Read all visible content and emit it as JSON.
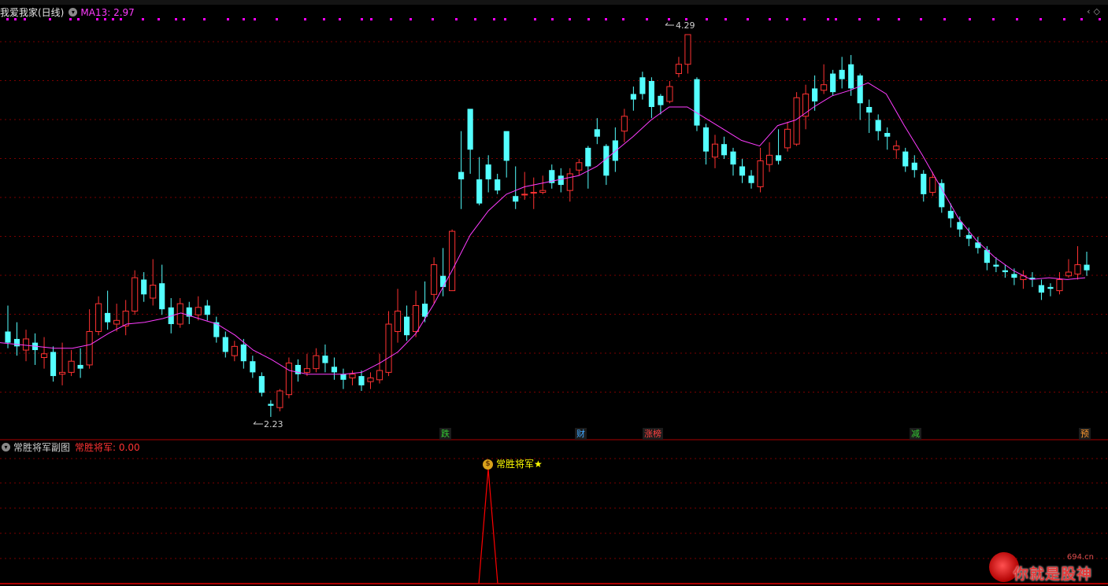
{
  "main_panel": {
    "stock_name": "我爱我家(日线)",
    "ma_label": "MA13: 2.97",
    "high_price_label": "4.29",
    "low_price_label": "2.23",
    "event_tags": [
      {
        "label": "跌",
        "color": "#33cc33"
      },
      {
        "label": "财",
        "color": "#40a8ff"
      },
      {
        "label": "涨榜",
        "color": "#ff4040"
      },
      {
        "label": "减",
        "color": "#33cc33"
      },
      {
        "label": "预",
        "color": "#ff9a30"
      }
    ]
  },
  "sub_panel": {
    "title": "常胜将军副图",
    "indicator_label": "常胜将军: 0.00",
    "signal_text": "常胜将军★",
    "signal_icon": "money-bag-icon"
  },
  "watermark": {
    "domain": "694.cn",
    "text": "你就是股神"
  },
  "colors": {
    "up": "#ff3232",
    "down": "#54ffff",
    "ma": "#ff3cff",
    "signal": "#ff0000",
    "grid": "#7a0000",
    "dots": "#ff00ff"
  },
  "chart_data": {
    "type": "candlestick",
    "series": [
      {
        "name": "MA13",
        "type": "line"
      }
    ],
    "ohlc": [
      [
        2.69,
        2.63,
        2.83,
        2.6
      ],
      [
        2.65,
        2.61,
        2.74,
        2.56
      ],
      [
        2.59,
        2.65,
        2.7,
        2.53
      ],
      [
        2.63,
        2.59,
        2.68,
        2.51
      ],
      [
        2.55,
        2.57,
        2.66,
        2.49
      ],
      [
        2.58,
        2.45,
        2.61,
        2.42
      ],
      [
        2.46,
        2.47,
        2.63,
        2.4
      ],
      [
        2.47,
        2.53,
        2.59,
        2.45
      ],
      [
        2.51,
        2.49,
        2.6,
        2.44
      ],
      [
        2.51,
        2.69,
        2.81,
        2.49
      ],
      [
        2.69,
        2.84,
        2.88,
        2.67
      ],
      [
        2.79,
        2.74,
        2.91,
        2.7
      ],
      [
        2.73,
        2.75,
        2.84,
        2.69
      ],
      [
        2.72,
        2.8,
        2.86,
        2.67
      ],
      [
        2.8,
        2.98,
        3.02,
        2.78
      ],
      [
        2.97,
        2.89,
        3.01,
        2.85
      ],
      [
        2.87,
        2.94,
        3.08,
        2.83
      ],
      [
        2.95,
        2.81,
        3.05,
        2.78
      ],
      [
        2.82,
        2.73,
        2.87,
        2.68
      ],
      [
        2.73,
        2.84,
        2.87,
        2.71
      ],
      [
        2.82,
        2.77,
        2.85,
        2.73
      ],
      [
        2.78,
        2.82,
        2.88,
        2.75
      ],
      [
        2.83,
        2.78,
        2.86,
        2.75
      ],
      [
        2.74,
        2.66,
        2.77,
        2.63
      ],
      [
        2.66,
        2.58,
        2.69,
        2.55
      ],
      [
        2.56,
        2.61,
        2.64,
        2.53
      ],
      [
        2.62,
        2.53,
        2.65,
        2.49
      ],
      [
        2.53,
        2.47,
        2.56,
        2.44
      ],
      [
        2.45,
        2.36,
        2.47,
        2.34
      ],
      [
        2.3,
        2.29,
        2.32,
        2.23
      ],
      [
        2.28,
        2.37,
        2.38,
        2.26
      ],
      [
        2.35,
        2.52,
        2.55,
        2.33
      ],
      [
        2.51,
        2.46,
        2.54,
        2.42
      ],
      [
        2.47,
        2.49,
        2.57,
        2.45
      ],
      [
        2.49,
        2.56,
        2.6,
        2.47
      ],
      [
        2.56,
        2.52,
        2.62,
        2.47
      ],
      [
        2.5,
        2.47,
        2.55,
        2.43
      ],
      [
        2.46,
        2.43,
        2.49,
        2.38
      ],
      [
        2.44,
        2.46,
        2.48,
        2.4
      ],
      [
        2.45,
        2.4,
        2.48,
        2.37
      ],
      [
        2.42,
        2.44,
        2.47,
        2.38
      ],
      [
        2.43,
        2.48,
        2.57,
        2.41
      ],
      [
        2.47,
        2.73,
        2.8,
        2.45
      ],
      [
        2.69,
        2.8,
        2.92,
        2.63
      ],
      [
        2.77,
        2.67,
        2.83,
        2.64
      ],
      [
        2.69,
        2.83,
        2.91,
        2.66
      ],
      [
        2.84,
        2.77,
        2.96,
        2.74
      ],
      [
        2.89,
        3.05,
        3.09,
        2.84
      ],
      [
        2.99,
        2.93,
        3.14,
        2.88
      ],
      [
        2.91,
        3.23,
        3.24,
        2.91
      ],
      [
        3.55,
        3.51,
        3.77,
        3.35
      ],
      [
        3.89,
        3.67,
        3.75,
        3.54
      ],
      [
        3.51,
        3.38,
        3.63,
        3.37
      ],
      [
        3.59,
        3.51,
        3.64,
        3.44
      ],
      [
        3.51,
        3.45,
        3.54,
        3.43
      ],
      [
        3.77,
        3.61,
        3.76,
        3.52
      ],
      [
        3.42,
        3.39,
        3.58,
        3.35
      ],
      [
        3.43,
        3.43,
        3.55,
        3.4
      ],
      [
        3.44,
        3.44,
        3.52,
        3.35
      ],
      [
        3.44,
        3.45,
        3.53,
        3.43
      ],
      [
        3.56,
        3.49,
        3.59,
        3.46
      ],
      [
        3.53,
        3.48,
        3.57,
        3.44
      ],
      [
        3.45,
        3.54,
        3.57,
        3.39
      ],
      [
        3.56,
        3.6,
        3.62,
        3.53
      ],
      [
        3.68,
        3.58,
        3.69,
        3.46
      ],
      [
        3.78,
        3.74,
        3.84,
        3.7
      ],
      [
        3.69,
        3.53,
        3.7,
        3.48
      ],
      [
        3.72,
        3.61,
        3.79,
        3.55
      ],
      [
        3.77,
        3.85,
        3.89,
        3.71
      ],
      [
        3.97,
        3.94,
        4.01,
        3.88
      ],
      [
        4.06,
        3.97,
        4.09,
        3.94
      ],
      [
        4.04,
        3.9,
        4.06,
        3.84
      ],
      [
        3.96,
        3.91,
        3.97,
        3.86
      ],
      [
        3.93,
        4.01,
        4.04,
        3.92
      ],
      [
        4.08,
        4.13,
        4.17,
        4.06
      ],
      [
        4.13,
        4.29,
        4.29,
        4.08
      ],
      [
        4.05,
        3.8,
        4.06,
        3.77
      ],
      [
        3.79,
        3.66,
        3.81,
        3.59
      ],
      [
        3.63,
        3.7,
        3.75,
        3.57
      ],
      [
        3.7,
        3.64,
        3.74,
        3.62
      ],
      [
        3.66,
        3.59,
        3.68,
        3.53
      ],
      [
        3.58,
        3.53,
        3.62,
        3.49
      ],
      [
        3.53,
        3.49,
        3.56,
        3.46
      ],
      [
        3.47,
        3.61,
        3.68,
        3.44
      ],
      [
        3.59,
        3.64,
        3.71,
        3.55
      ],
      [
        3.64,
        3.61,
        3.78,
        3.59
      ],
      [
        3.68,
        3.78,
        3.82,
        3.66
      ],
      [
        3.7,
        3.95,
        3.98,
        3.69
      ],
      [
        3.85,
        3.97,
        4.02,
        3.78
      ],
      [
        4.0,
        3.93,
        4.07,
        3.88
      ],
      [
        3.99,
        4.02,
        4.13,
        3.97
      ],
      [
        4.08,
        3.98,
        4.1,
        3.96
      ],
      [
        4.1,
        4.05,
        4.17,
        4.0
      ],
      [
        4.13,
        4.0,
        4.18,
        3.96
      ],
      [
        4.07,
        3.92,
        4.08,
        3.83
      ],
      [
        3.9,
        3.87,
        3.94,
        3.76
      ],
      [
        3.83,
        3.77,
        3.86,
        3.72
      ],
      [
        3.76,
        3.74,
        3.79,
        3.67
      ],
      [
        3.67,
        3.69,
        3.72,
        3.62
      ],
      [
        3.66,
        3.58,
        3.68,
        3.55
      ],
      [
        3.6,
        3.56,
        3.64,
        3.52
      ],
      [
        3.54,
        3.43,
        3.56,
        3.39
      ],
      [
        3.44,
        3.52,
        3.55,
        3.42
      ],
      [
        3.49,
        3.36,
        3.51,
        3.33
      ],
      [
        3.34,
        3.3,
        3.38,
        3.25
      ],
      [
        3.28,
        3.24,
        3.31,
        3.2
      ],
      [
        3.21,
        3.19,
        3.25,
        3.15
      ],
      [
        3.17,
        3.14,
        3.2,
        3.11
      ],
      [
        3.13,
        3.06,
        3.15,
        3.02
      ],
      [
        3.05,
        3.04,
        3.09,
        3.01
      ],
      [
        3.02,
        3.01,
        3.05,
        2.98
      ],
      [
        3.0,
        2.98,
        3.03,
        2.94
      ],
      [
        2.97,
        2.99,
        3.02,
        2.92
      ],
      [
        2.98,
        2.97,
        3.01,
        2.93
      ],
      [
        2.94,
        2.9,
        2.97,
        2.86
      ],
      [
        2.93,
        2.92,
        2.95,
        2.88
      ],
      [
        2.91,
        2.97,
        3.01,
        2.89
      ],
      [
        2.99,
        3.01,
        3.08,
        2.98
      ],
      [
        3.0,
        3.05,
        3.15,
        2.97
      ],
      [
        3.05,
        3.02,
        3.12,
        2.99
      ]
    ],
    "ma13": [
      2.63,
      2.62,
      2.61,
      2.6,
      2.6,
      2.62,
      2.68,
      2.73,
      2.74,
      2.76,
      2.79,
      2.76,
      2.73,
      2.67,
      2.59,
      2.54,
      2.48,
      2.46,
      2.46,
      2.46,
      2.47,
      2.52,
      2.58,
      2.68,
      2.84,
      3.02,
      3.21,
      3.34,
      3.43,
      3.47,
      3.49,
      3.51,
      3.53,
      3.58,
      3.66,
      3.74,
      3.83,
      3.9,
      3.9,
      3.84,
      3.78,
      3.72,
      3.69,
      3.8,
      3.83,
      3.9,
      3.96,
      3.99,
      4.03,
      3.97,
      3.8,
      3.64,
      3.47,
      3.3,
      3.18,
      3.09,
      3.02,
      2.97,
      2.98,
      2.97,
      2.98
    ],
    "ylim": [
      2.23,
      4.29
    ],
    "legend": "top-left",
    "grid": true
  }
}
